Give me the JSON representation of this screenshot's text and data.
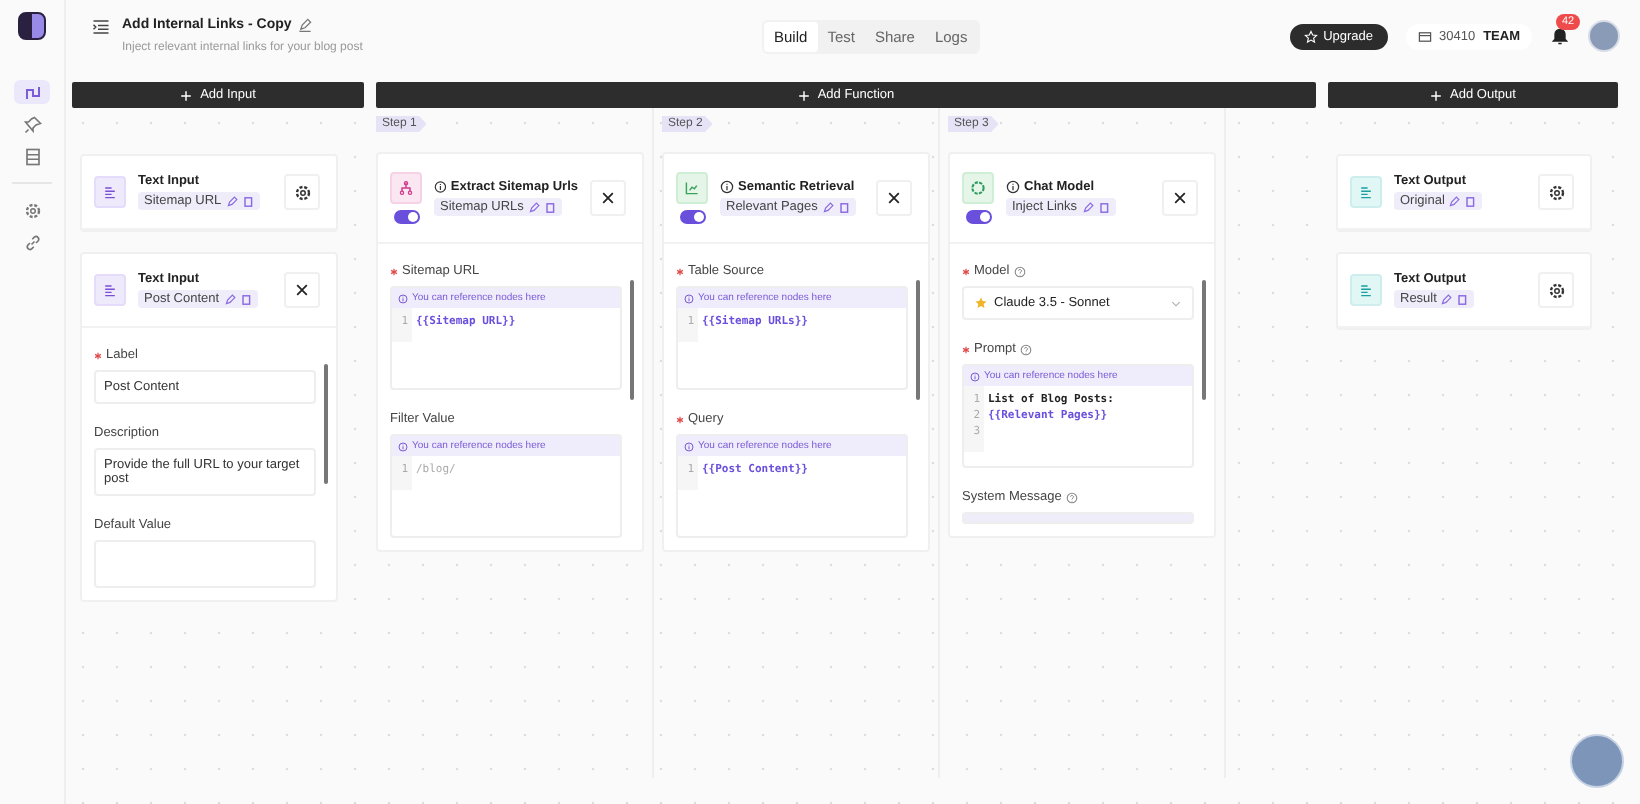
{
  "app": {
    "title": "Add Internal Links - Copy",
    "subtitle": "Inject relevant internal links for your blog post"
  },
  "sidebar": {
    "items": [
      {
        "kind": "flow",
        "selected": true
      },
      {
        "kind": "pin",
        "selected": false
      },
      {
        "kind": "database",
        "selected": false
      },
      {
        "kind": "settings",
        "selected": false
      },
      {
        "kind": "link",
        "selected": false
      }
    ]
  },
  "tabs": [
    {
      "label": "Build",
      "selected": true
    },
    {
      "label": "Test",
      "selected": false
    },
    {
      "label": "Share",
      "selected": false
    },
    {
      "label": "Logs",
      "selected": false
    }
  ],
  "upgrade": "Upgrade",
  "credits": {
    "amount": "30410",
    "plan": "TEAM"
  },
  "notifications": {
    "count": "42"
  },
  "input": {
    "button": "Add Input",
    "nodes": [
      {
        "type": "Text Input",
        "name": "Sitemap URL",
        "kind": "settings"
      },
      {
        "type": "Text Input",
        "name": "Post Content",
        "kind": "close",
        "fields": [
          {
            "label": "Label",
            "required": true,
            "kind": "input",
            "value": "Post Content"
          },
          {
            "label": "Description",
            "required": false,
            "kind": "textarea",
            "value": "Provide the full URL to your target post"
          },
          {
            "label": "Default Value",
            "required": false,
            "kind": "textarea"
          }
        ]
      }
    ]
  },
  "function": {
    "button": "Add Function",
    "steps": [
      {
        "step": "Step 1",
        "title": "Extract Sitemap Urls",
        "name": "Sitemap URLs",
        "kind": "sitemap",
        "enabled": true,
        "fields": [
          {
            "label": "Sitemap URL",
            "required": true,
            "kind": "code",
            "hint": "You can reference nodes here",
            "lines": [
              {
                "number": "1",
                "text": "{{Sitemap URL}}",
                "kind": "variable"
              }
            ]
          },
          {
            "label": "Filter Value",
            "required": false,
            "kind": "code",
            "hint": "You can reference nodes here",
            "lines": [
              {
                "number": "1",
                "text": "/blog/",
                "kind": "placeholder"
              }
            ]
          }
        ]
      },
      {
        "step": "Step 2",
        "title": "Semantic Retrieval",
        "name": "Relevant Pages",
        "kind": "chart",
        "enabled": true,
        "fields": [
          {
            "label": "Table Source",
            "required": true,
            "kind": "code",
            "hint": "You can reference nodes here",
            "lines": [
              {
                "number": "1",
                "text": "{{Sitemap URLs}}",
                "kind": "variable"
              }
            ]
          },
          {
            "label": "Query",
            "required": true,
            "kind": "code",
            "hint": "You can reference nodes here",
            "lines": [
              {
                "number": "1",
                "text": "{{Post Content}}",
                "kind": "variable"
              }
            ]
          }
        ]
      },
      {
        "step": "Step 3",
        "title": "Chat Model",
        "name": "Inject Links",
        "kind": "ai",
        "enabled": true,
        "fields": [
          {
            "label": "Model",
            "required": true,
            "help": true,
            "kind": "select",
            "value": "Claude 3.5 - Sonnet"
          },
          {
            "label": "Prompt",
            "required": true,
            "help": true,
            "kind": "code",
            "hint": "You can reference nodes here",
            "lines": [
              {
                "number": "1",
                "text": "List of Blog Posts:",
                "kind": "text"
              },
              {
                "number": "2",
                "text": "{{Relevant Pages}}",
                "kind": "variable"
              },
              {
                "number": "3"
              }
            ]
          },
          {
            "label": "System Message",
            "required": false,
            "help": true,
            "kind": "code"
          }
        ]
      }
    ]
  },
  "output": {
    "button": "Add Output",
    "nodes": [
      {
        "type": "Text Output",
        "name": "Original",
        "kind": "settings"
      },
      {
        "type": "Text Output",
        "name": "Result",
        "kind": "settings"
      }
    ]
  }
}
